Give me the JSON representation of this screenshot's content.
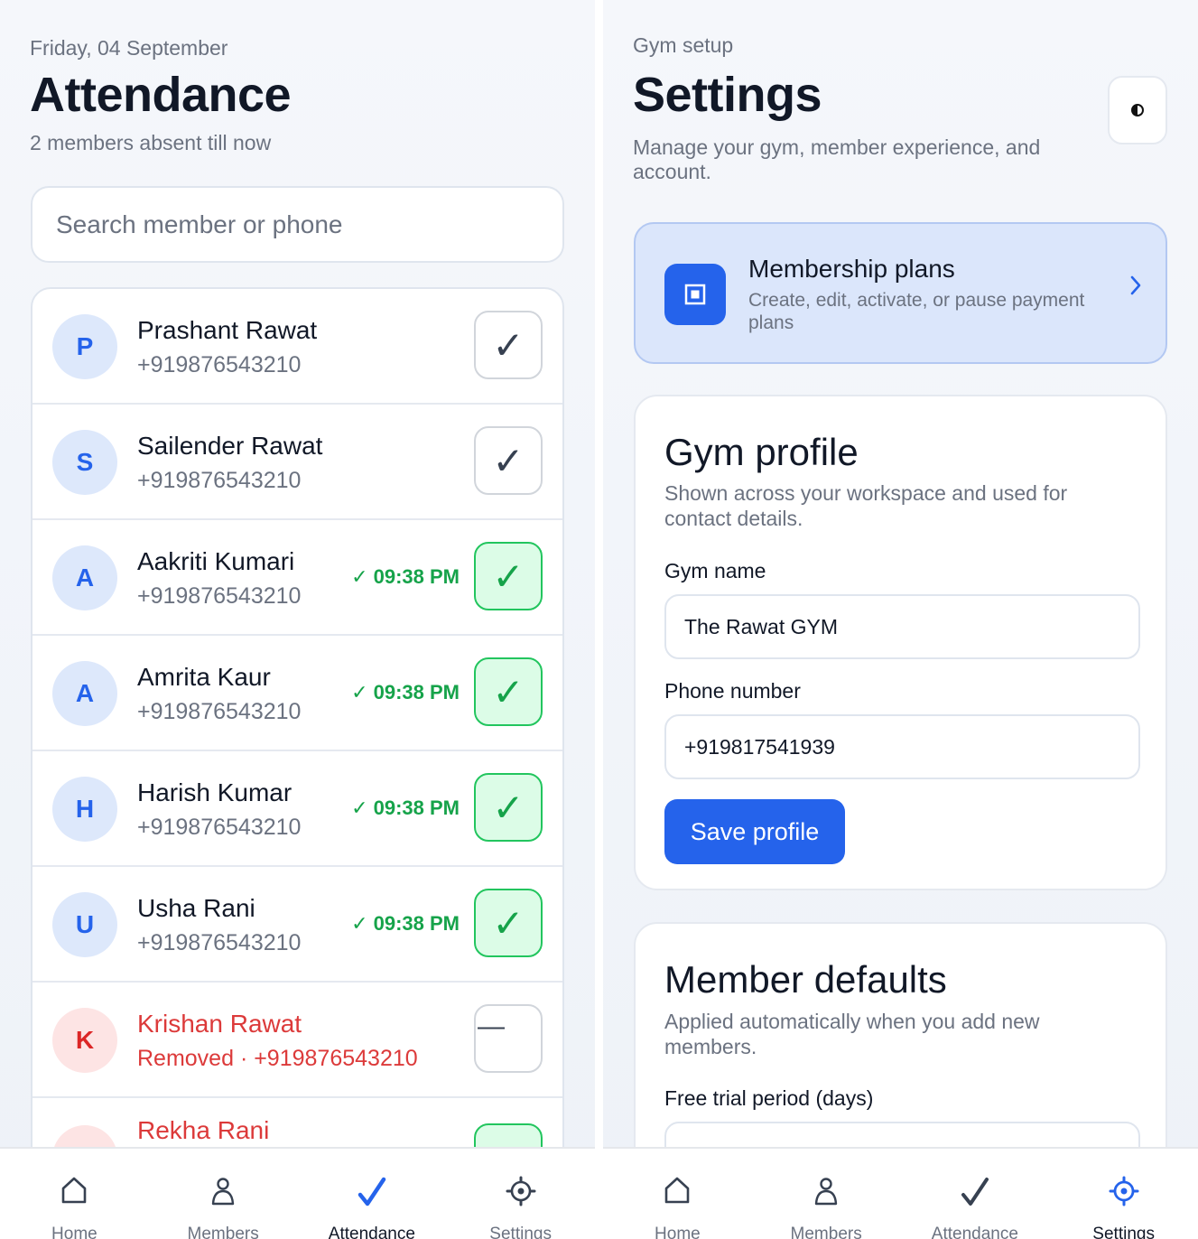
{
  "attendance": {
    "date": "Friday, 04 September",
    "title": "Attendance",
    "absent_summary": "2 members absent till now",
    "search_placeholder": "Search member or phone",
    "members": [
      {
        "initial": "P",
        "name": "Prashant Rawat",
        "phone": "+919876543210",
        "time": "",
        "status": "unmarked"
      },
      {
        "initial": "S",
        "name": "Sailender Rawat",
        "phone": "+919876543210",
        "time": "",
        "status": "unmarked"
      },
      {
        "initial": "A",
        "name": "Aakriti Kumari",
        "phone": "+919876543210",
        "time": "✓ 09:38 PM",
        "status": "present"
      },
      {
        "initial": "A",
        "name": "Amrita Kaur",
        "phone": "+919876543210",
        "time": "✓ 09:38 PM",
        "status": "present"
      },
      {
        "initial": "H",
        "name": "Harish Kumar",
        "phone": "+919876543210",
        "time": "✓ 09:38 PM",
        "status": "present"
      },
      {
        "initial": "U",
        "name": "Usha Rani",
        "phone": "+919876543210",
        "time": "✓ 09:38 PM",
        "status": "present"
      },
      {
        "initial": "K",
        "name": "Krishan Rawat",
        "phone": "Removed · +919876543210",
        "time": "",
        "status": "removed"
      },
      {
        "initial": "R",
        "name": "Rekha Rani",
        "phone": "",
        "time": "",
        "status": "removed-partial"
      }
    ],
    "check_glyph": "✓",
    "removed_glyph": "—"
  },
  "settings": {
    "eyebrow": "Gym setup",
    "title": "Settings",
    "description": "Manage your gym, member experience, and account.",
    "theme_toggle_icon": "contrast-icon",
    "plans": {
      "title": "Membership plans",
      "description": "Create, edit, activate, or pause payment plans"
    },
    "gym_profile": {
      "title": "Gym profile",
      "description": "Shown across your workspace and used for contact details.",
      "gym_name_label": "Gym name",
      "gym_name_value": "The Rawat GYM",
      "phone_label": "Phone number",
      "phone_value": "+919817541939",
      "save_label": "Save profile"
    },
    "member_defaults": {
      "title": "Member defaults",
      "description": "Applied automatically when you add new members.",
      "trial_label": "Free trial period (days)"
    }
  },
  "nav": {
    "home": "Home",
    "members": "Members",
    "attendance": "Attendance",
    "settings": "Settings"
  },
  "colors": {
    "accent": "#2563eb",
    "present": "#16a34a",
    "removed": "#dc2626"
  }
}
